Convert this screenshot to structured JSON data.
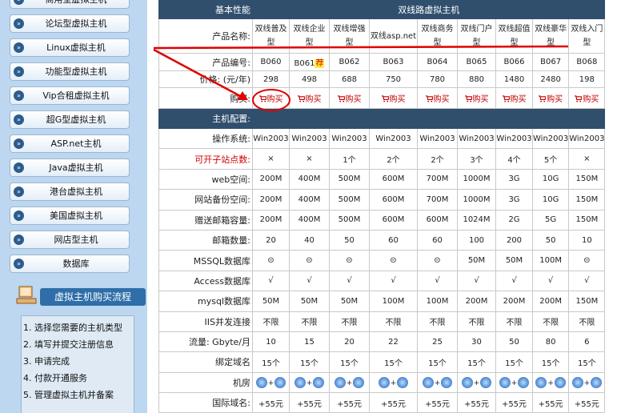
{
  "sidebar": {
    "items": [
      {
        "label": "商用型虚拟主机"
      },
      {
        "label": "论坛型虚拟主机"
      },
      {
        "label": "Linux虚拟主机"
      },
      {
        "label": "功能型虚拟主机"
      },
      {
        "label": "Vip合租虚拟主机"
      },
      {
        "label": "超G型虚拟主机"
      },
      {
        "label": "ASP.net主机"
      },
      {
        "label": "Java虚拟主机"
      },
      {
        "label": "港台虚拟主机"
      },
      {
        "label": "美国虚拟主机"
      },
      {
        "label": "网店型主机"
      },
      {
        "label": "数据库"
      }
    ],
    "flow_title": "虚拟主机购买流程",
    "flow_steps": [
      "1. 选择您需要的主机类型",
      "2. 填写并提交注册信息",
      "3. 申请完成",
      "4. 付款开通服务",
      "5. 管理虚拟主机并备案"
    ]
  },
  "table": {
    "header_label": "基本性能",
    "header_title": "双线路虚拟主机",
    "name_label": "产品名称:",
    "products": [
      {
        "name": "双线普及型",
        "code": "B060",
        "price": "298"
      },
      {
        "name": "双线企业型",
        "code": "B061",
        "price": "498",
        "badge": "荐"
      },
      {
        "name": "双线增强型",
        "code": "B062",
        "price": "688"
      },
      {
        "name": "双线asp.net",
        "code": "B063",
        "price": "750"
      },
      {
        "name": "双线商务型",
        "code": "B064",
        "price": "780"
      },
      {
        "name": "双线门户型",
        "code": "B065",
        "price": "880"
      },
      {
        "name": "双线超值型",
        "code": "B066",
        "price": "1480"
      },
      {
        "name": "双线豪华型",
        "code": "B067",
        "price": "2480"
      },
      {
        "name": "双线入门型",
        "code": "B068",
        "price": "198"
      }
    ],
    "code_label": "产品编号:",
    "price_label": "价格: (元/年)",
    "buy_label": "购买:",
    "buy_text": "购买",
    "config_label": "主机配置:",
    "rows": [
      {
        "label": "操作系统:",
        "red": false,
        "values": [
          "Win2003",
          "Win2003",
          "Win2003",
          "Win2003",
          "Win2003",
          "Win2003",
          "Win2003",
          "Win2003",
          "Win2003"
        ]
      },
      {
        "label": "可开子站点数:",
        "red": true,
        "values": [
          "×",
          "×",
          "1个",
          "2个",
          "2个",
          "3个",
          "4个",
          "5个",
          "×"
        ]
      },
      {
        "label": "web空间:",
        "red": false,
        "values": [
          "200M",
          "400M",
          "500M",
          "600M",
          "700M",
          "1000M",
          "3G",
          "10G",
          "150M"
        ]
      },
      {
        "label": "网站备份空间:",
        "red": false,
        "values": [
          "200M",
          "400M",
          "500M",
          "600M",
          "700M",
          "1000M",
          "3G",
          "10G",
          "150M"
        ]
      },
      {
        "label": "赠送邮箱容量:",
        "red": false,
        "values": [
          "200M",
          "400M",
          "500M",
          "600M",
          "600M",
          "1024M",
          "2G",
          "5G",
          "150M"
        ]
      },
      {
        "label": "邮箱数量:",
        "red": false,
        "values": [
          "20",
          "40",
          "50",
          "60",
          "60",
          "100",
          "200",
          "50",
          "10"
        ]
      },
      {
        "label": "MSSQL数据库",
        "red": false,
        "values": [
          "⊝",
          "⊝",
          "⊝",
          "⊝",
          "⊝",
          "50M",
          "50M",
          "100M",
          "⊝"
        ]
      },
      {
        "label": "Access数据库",
        "red": false,
        "values": [
          "√",
          "√",
          "√",
          "√",
          "√",
          "√",
          "√",
          "√",
          "√"
        ]
      },
      {
        "label": "mysql数据库",
        "red": false,
        "values": [
          "50M",
          "50M",
          "50M",
          "100M",
          "100M",
          "200M",
          "200M",
          "200M",
          "150M"
        ]
      },
      {
        "label": "IIS并发连接",
        "red": false,
        "values": [
          "不限",
          "不限",
          "不限",
          "不限",
          "不限",
          "不限",
          "不限",
          "不限",
          "不限"
        ]
      },
      {
        "label": "流量: Gbyte/月",
        "red": false,
        "values": [
          "10",
          "15",
          "20",
          "22",
          "25",
          "30",
          "50",
          "80",
          "6"
        ]
      },
      {
        "label": "绑定域名",
        "red": false,
        "values": [
          "15个",
          "15个",
          "15个",
          "15个",
          "15个",
          "15个",
          "15个",
          "15个",
          "15个"
        ]
      },
      {
        "label": "机房",
        "red": false,
        "room": true,
        "values": [
          "+",
          "+",
          "+",
          "+",
          "+",
          "+",
          "+",
          "+",
          "+"
        ]
      },
      {
        "label": "国际域名:",
        "red": false,
        "values": [
          "+55元",
          "+55元",
          "+55元",
          "+55元",
          "+55元",
          "+55元",
          "+55元",
          "+55元",
          "+55元"
        ]
      }
    ]
  },
  "colors": {
    "header": "#2f4f6d",
    "sidebar": "#bcd7ef",
    "red": "#d00000",
    "annotation": "#e00000"
  }
}
